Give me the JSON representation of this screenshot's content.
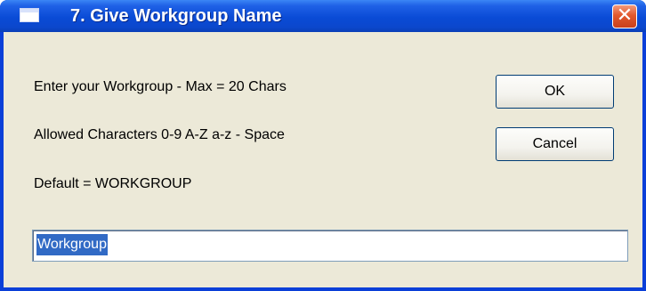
{
  "window": {
    "title": "7. Give Workgroup Name"
  },
  "icons": {
    "app": "window-icon",
    "close": "close-icon"
  },
  "titlebar": {
    "close_glyph": "✕"
  },
  "dialog": {
    "line1": "Enter your Workgroup - Max = 20 Chars",
    "line2": "Allowed Characters 0-9 A-Z a-z - Space",
    "line3": "Default = WORKGROUP",
    "ok_label": "OK",
    "cancel_label": "Cancel",
    "input_value": "Workgroup"
  },
  "colors": {
    "titlebar_blue": "#0a4bd6",
    "dialog_background": "#ece9d8",
    "selection_highlight": "#316ac5",
    "close_button": "#e2582c"
  }
}
